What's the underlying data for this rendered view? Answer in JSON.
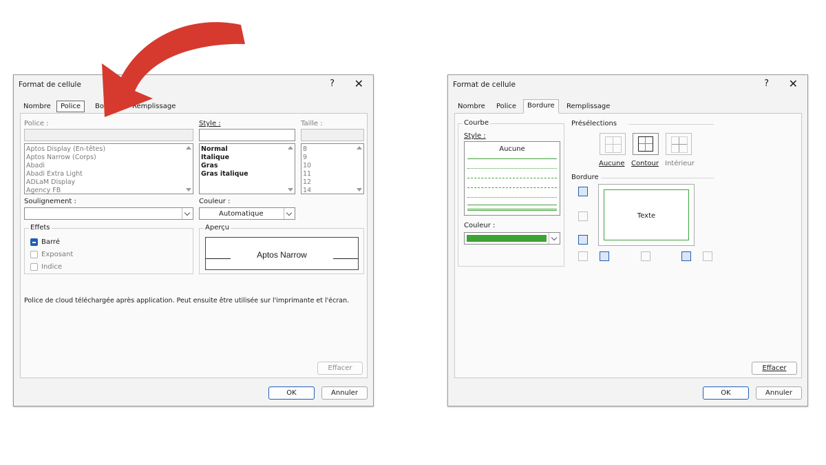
{
  "dialog_left": {
    "title": "Format de cellule",
    "help": "?",
    "close": "✕",
    "tabs": [
      "Nombre",
      "Police",
      "Bordure",
      "Remplissage"
    ],
    "active_tab": "Police",
    "police_label": "Police :",
    "style_label": "Style :",
    "taille_label": "Taille :",
    "fonts": [
      "Aptos Display (En-têtes)",
      "Aptos Narrow (Corps)",
      "Abadi",
      "Abadi Extra Light",
      "ADLaM Display",
      "Agency FB"
    ],
    "styles": [
      "Normal",
      "Italique",
      "Gras",
      "Gras italique"
    ],
    "sizes": [
      "8",
      "9",
      "10",
      "11",
      "12",
      "14"
    ],
    "soulignement_label": "Soulignement :",
    "couleur_label": "Couleur :",
    "couleur_value": "Automatique",
    "effets_label": "Effets",
    "effets": [
      {
        "label": "Barré",
        "checked": true
      },
      {
        "label": "Exposant",
        "checked": false
      },
      {
        "label": "Indice",
        "checked": false
      }
    ],
    "apercu_label": "Aperçu",
    "apercu_text": "Aptos Narrow",
    "info_text": "Police de cloud téléchargée après application. Peut ensuite être utilisée sur l'imprimante et l'écran.",
    "effacer": "Effacer",
    "ok": "OK",
    "annuler": "Annuler"
  },
  "dialog_right": {
    "title": "Format de cellule",
    "help": "?",
    "close": "✕",
    "tabs": [
      "Nombre",
      "Police",
      "Bordure",
      "Remplissage"
    ],
    "active_tab": "Bordure",
    "courbe_label": "Courbe",
    "style_label": "Style :",
    "style_none": "Aucune",
    "couleur_label": "Couleur :",
    "couleur_hex": "#3ea335",
    "presets_label": "Présélections",
    "presets": [
      "Aucune",
      "Contour",
      "Intérieur"
    ],
    "bordure_label": "Bordure",
    "preview_text": "Texte",
    "effacer": "Effacer",
    "ok": "OK",
    "annuler": "Annuler"
  },
  "colors": {
    "arrow": "#d63a2f",
    "accent": "#1f5fb5",
    "border_green": "#3ea335"
  }
}
